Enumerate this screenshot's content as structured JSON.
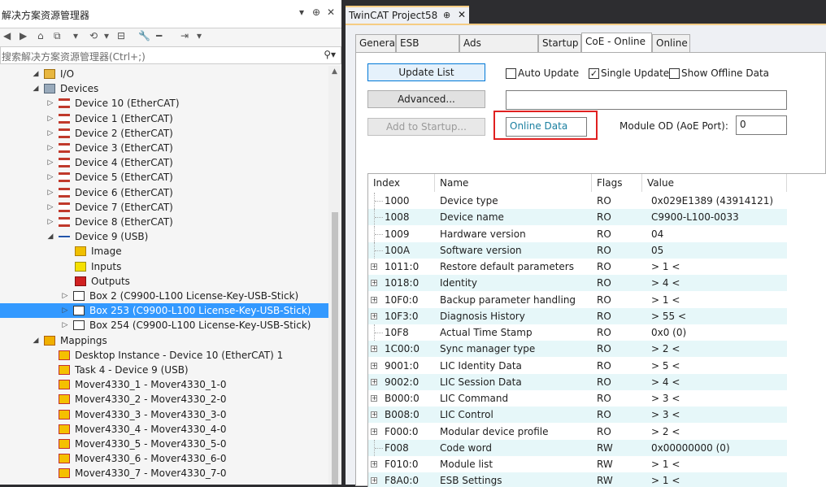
{
  "left_panel": {
    "title": "解决方案资源管理器",
    "search_placeholder": "搜索解决方案资源管理器(Ctrl+;)",
    "tree": [
      {
        "label": "I/O",
        "icon": "io-folder-icon",
        "expand": "◢"
      },
      {
        "label": "Devices",
        "icon": "devices-icon",
        "expand": "◢"
      },
      {
        "label": "Device 10 (EtherCAT)",
        "icon": "ethercat-device-icon",
        "expand": "▷"
      },
      {
        "label": "Device 1 (EtherCAT)",
        "icon": "ethercat-device-icon",
        "expand": "▷"
      },
      {
        "label": "Device 2 (EtherCAT)",
        "icon": "ethercat-device-icon",
        "expand": "▷"
      },
      {
        "label": "Device 3 (EtherCAT)",
        "icon": "ethercat-device-icon",
        "expand": "▷"
      },
      {
        "label": "Device 4 (EtherCAT)",
        "icon": "ethercat-device-icon",
        "expand": "▷"
      },
      {
        "label": "Device 5 (EtherCAT)",
        "icon": "ethercat-device-icon",
        "expand": "▷"
      },
      {
        "label": "Device 6 (EtherCAT)",
        "icon": "ethercat-device-icon",
        "expand": "▷"
      },
      {
        "label": "Device 7 (EtherCAT)",
        "icon": "ethercat-device-icon",
        "expand": "▷"
      },
      {
        "label": "Device 8 (EtherCAT)",
        "icon": "ethercat-device-icon",
        "expand": "▷"
      },
      {
        "label": "Device 9 (USB)",
        "icon": "usb-device-icon",
        "expand": "◢"
      },
      {
        "label": "Image",
        "icon": "image-icon",
        "expand": ""
      },
      {
        "label": "Inputs",
        "icon": "inputs-icon",
        "expand": ""
      },
      {
        "label": "Outputs",
        "icon": "outputs-icon",
        "expand": ""
      },
      {
        "label": "Box 2 (C9900-L100 License-Key-USB-Stick)",
        "icon": "box-icon",
        "expand": "▷"
      },
      {
        "label": "Box 253 (C9900-L100 License-Key-USB-Stick)",
        "icon": "box-icon",
        "expand": "▷",
        "selected": true
      },
      {
        "label": "Box 254 (C9900-L100 License-Key-USB-Stick)",
        "icon": "box-icon",
        "expand": "▷"
      },
      {
        "label": "Mappings",
        "icon": "mappings-icon",
        "expand": "◢"
      },
      {
        "label": "Desktop Instance - Device 10 (EtherCAT) 1",
        "icon": "mapping-icon",
        "expand": ""
      },
      {
        "label": "Task 4 - Device 9 (USB)",
        "icon": "mapping-icon",
        "expand": ""
      },
      {
        "label": "Mover4330_1 - Mover4330_1-0",
        "icon": "mapping-icon",
        "expand": ""
      },
      {
        "label": "Mover4330_2 - Mover4330_2-0",
        "icon": "mapping-icon",
        "expand": ""
      },
      {
        "label": "Mover4330_3 - Mover4330_3-0",
        "icon": "mapping-icon",
        "expand": ""
      },
      {
        "label": "Mover4330_4 - Mover4330_4-0",
        "icon": "mapping-icon",
        "expand": ""
      },
      {
        "label": "Mover4330_5 - Mover4330_5-0",
        "icon": "mapping-icon",
        "expand": ""
      },
      {
        "label": "Mover4330_6 - Mover4330_6-0",
        "icon": "mapping-icon",
        "expand": ""
      },
      {
        "label": "Mover4330_7 - Mover4330_7-0",
        "icon": "mapping-icon",
        "expand": ""
      }
    ]
  },
  "doc_tab": {
    "title": "TwinCAT Project58",
    "pin": "⊕",
    "close": "✕"
  },
  "tabs": [
    "General",
    "ESB Device",
    "Ads Commands",
    "Startup",
    "CoE - Online",
    "Online"
  ],
  "active_tab": "CoE - Online",
  "coe": {
    "update_list": "Update List",
    "advanced": "Advanced...",
    "add_to_startup": "Add to Startup...",
    "auto_update": "Auto Update",
    "auto_update_checked": false,
    "single_update": "Single Update",
    "single_update_checked": true,
    "show_offline": "Show Offline Data",
    "show_offline_checked": false,
    "online_data": "Online Data",
    "module_od_label": "Module OD (AoE Port):",
    "module_od_value": "0"
  },
  "table": {
    "headers": [
      "Index",
      "Name",
      "Flags",
      "Value"
    ],
    "rows": [
      {
        "index": "1000",
        "name": "Device type",
        "flags": "RO",
        "value": "0x029E1389 (43914121)",
        "exp": false
      },
      {
        "index": "1008",
        "name": "Device name",
        "flags": "RO",
        "value": "C9900-L100-0033",
        "exp": false
      },
      {
        "index": "1009",
        "name": "Hardware version",
        "flags": "RO",
        "value": "04",
        "exp": false
      },
      {
        "index": "100A",
        "name": "Software version",
        "flags": "RO",
        "value": "05",
        "exp": false
      },
      {
        "index": "1011:0",
        "name": "Restore default parameters",
        "flags": "RO",
        "value": "> 1 <",
        "exp": true
      },
      {
        "index": "1018:0",
        "name": "Identity",
        "flags": "RO",
        "value": "> 4 <",
        "exp": true
      },
      {
        "index": "10F0:0",
        "name": "Backup parameter handling",
        "flags": "RO",
        "value": "> 1 <",
        "exp": true
      },
      {
        "index": "10F3:0",
        "name": "Diagnosis History",
        "flags": "RO",
        "value": "> 55 <",
        "exp": true
      },
      {
        "index": "10F8",
        "name": "Actual Time Stamp",
        "flags": "RO",
        "value": "0x0 (0)",
        "exp": false
      },
      {
        "index": "1C00:0",
        "name": "Sync manager type",
        "flags": "RO",
        "value": "> 2 <",
        "exp": true
      },
      {
        "index": "9001:0",
        "name": "LIC Identity Data",
        "flags": "RO",
        "value": "> 5 <",
        "exp": true
      },
      {
        "index": "9002:0",
        "name": "LIC Session Data",
        "flags": "RO",
        "value": "> 4 <",
        "exp": true
      },
      {
        "index": "B000:0",
        "name": "LIC Command",
        "flags": "RO",
        "value": "> 3 <",
        "exp": true
      },
      {
        "index": "B008:0",
        "name": "LIC Control",
        "flags": "RO",
        "value": "> 3 <",
        "exp": true
      },
      {
        "index": "F000:0",
        "name": "Modular device profile",
        "flags": "RO",
        "value": "> 2 <",
        "exp": true
      },
      {
        "index": "F008",
        "name": "Code word",
        "flags": "RW",
        "value": "0x00000000 (0)",
        "exp": false
      },
      {
        "index": "F010:0",
        "name": "Module list",
        "flags": "RW",
        "value": "> 1 <",
        "exp": true
      },
      {
        "index": "F8A0:0",
        "name": "ESB Settings",
        "flags": "RW",
        "value": "> 1 <",
        "exp": true
      }
    ]
  },
  "colors": {
    "selection": "#3399ff",
    "highlight_box": "#e02020",
    "row_alt": "#e6f7f9",
    "tab_accent": "#f5cc84"
  }
}
